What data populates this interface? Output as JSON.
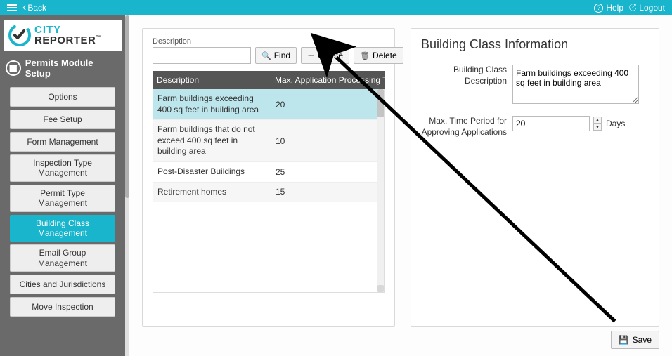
{
  "topbar": {
    "back": "Back",
    "help": "Help",
    "logout": "Logout"
  },
  "logo": {
    "line1": "CITY",
    "line2": "REPORTER",
    "tm": "™"
  },
  "module_title": "Permits Module Setup",
  "sidebar": {
    "items": [
      {
        "label": "Options",
        "active": false
      },
      {
        "label": "Fee Setup",
        "active": false
      },
      {
        "label": "Form Management",
        "active": false
      },
      {
        "label": "Inspection Type Management",
        "active": false
      },
      {
        "label": "Permit Type Management",
        "active": false
      },
      {
        "label": "Building Class Management",
        "active": true
      },
      {
        "label": "Email Group Management",
        "active": false
      },
      {
        "label": "Cities and Jurisdictions",
        "active": false
      },
      {
        "label": "Move Inspection",
        "active": false
      }
    ]
  },
  "list_panel": {
    "search_label": "Description",
    "search_value": "",
    "find": "Find",
    "create": "Create",
    "delete": "Delete",
    "columns": {
      "c1": "Description",
      "c2": "Max. Application Processing Time ..."
    },
    "rows": [
      {
        "desc": "Farm buildings exceeding 400 sq feet in building area",
        "val": "20",
        "selected": true
      },
      {
        "desc": "Farm buildings that do not exceed 400 sq feet in building area",
        "val": "10",
        "selected": false
      },
      {
        "desc": "Post-Disaster Buildings",
        "val": "25",
        "selected": false
      },
      {
        "desc": "Retirement homes",
        "val": "15",
        "selected": false
      }
    ]
  },
  "detail_panel": {
    "title": "Building Class Information",
    "desc_label": "Building Class Description",
    "desc_value": "Farm buildings exceeding 400 sq feet in building area",
    "time_label": "Max. Time Period for Approving Applications",
    "time_value": "20",
    "time_unit": "Days"
  },
  "save_label": "Save"
}
